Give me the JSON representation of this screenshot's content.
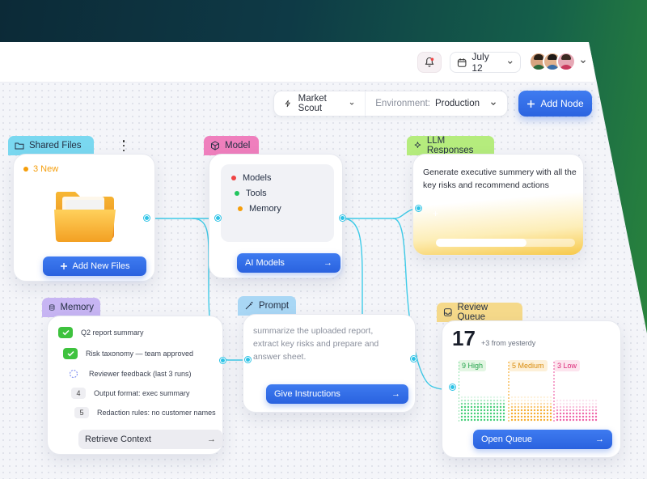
{
  "topbar": {
    "date_label": "July 12"
  },
  "toolbar": {
    "agent_label": "Market Scout",
    "env_label": "Environment:",
    "env_value": "Production",
    "add_node_label": "Add Node"
  },
  "nodes": {
    "shared_files": {
      "title": "Shared Files",
      "badge": "3 New",
      "button": "Add New Files"
    },
    "model": {
      "title": "Model",
      "items": [
        "Models",
        "Tools",
        "Memory"
      ],
      "item_colors": [
        "#ef4444",
        "#22c55e",
        "#f59e0b"
      ],
      "button": "AI Models"
    },
    "llm_responses": {
      "title": "LLM Responses",
      "text": "Generate executive summery with all the key risks and recommend actions"
    },
    "memory": {
      "title": "Memory",
      "items": [
        {
          "marker": "check",
          "text": "Q2 report summary"
        },
        {
          "marker": "check",
          "text": "Risk taxonomy — team approved"
        },
        {
          "marker": "loading",
          "text": "Reviewer feedback (last 3 runs)"
        },
        {
          "marker": "4",
          "text": "Output format: exec summary"
        },
        {
          "marker": "5",
          "text": "Redaction rules: no customer names"
        }
      ],
      "button": "Retrieve Context"
    },
    "prompt": {
      "title": "Prompt",
      "text": "summarize the uploaded report, extract key risks and prepare and answer sheet.",
      "button": "Give Instructions"
    },
    "review_queue": {
      "title": "Review Queue",
      "count": "17",
      "delta": "+3 from yesterdy",
      "columns": [
        {
          "label": "9 High",
          "color": "#22c55e"
        },
        {
          "label": "5 Medium",
          "color": "#f59e0b"
        },
        {
          "label": "3 Low",
          "color": "#ec4899"
        }
      ],
      "button": "Open Queue"
    }
  }
}
